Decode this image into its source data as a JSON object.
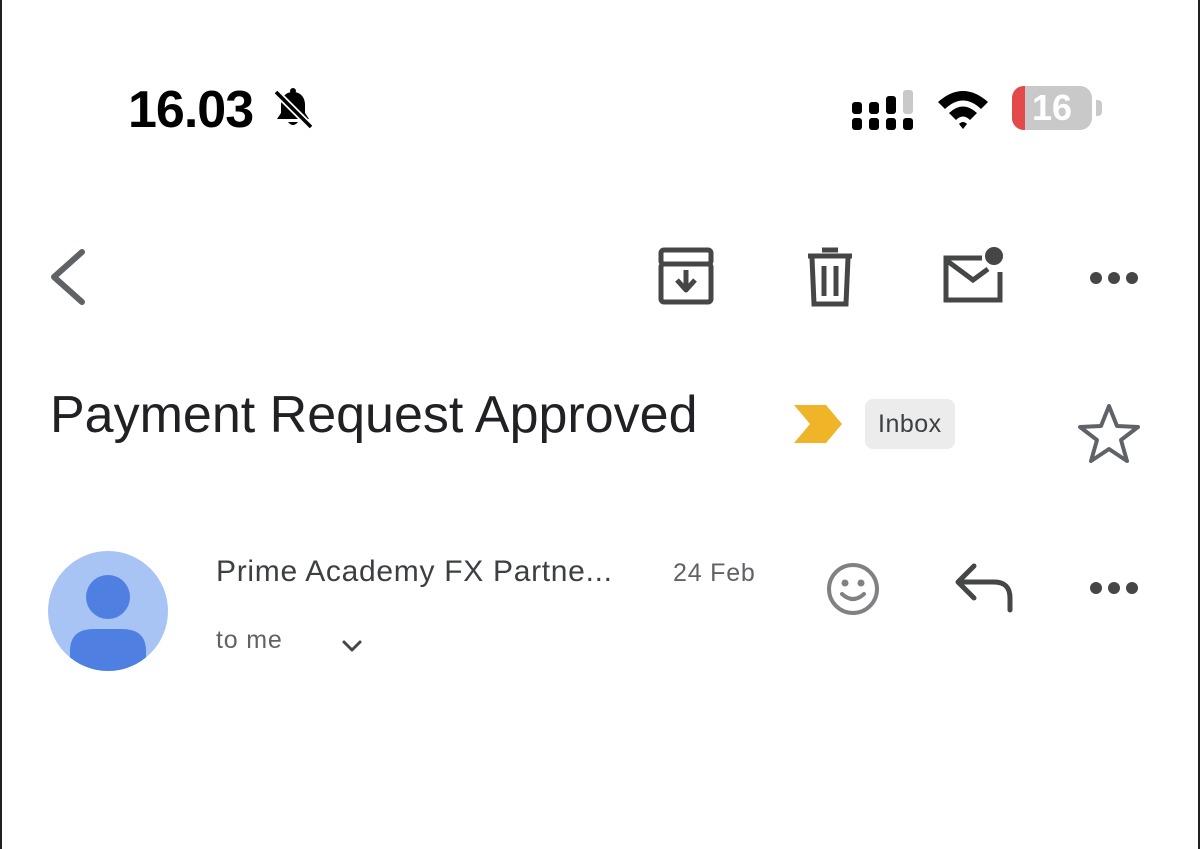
{
  "status_bar": {
    "time": "16.03",
    "battery_level": "16",
    "battery_fraction": 0.16,
    "icons": [
      "bell-slash-icon",
      "signal-icon",
      "wifi-icon",
      "battery-icon"
    ]
  },
  "toolbar": {
    "icons": [
      "back-icon",
      "archive-icon",
      "delete-icon",
      "mark-unread-icon",
      "more-icon"
    ]
  },
  "email": {
    "subject": "Payment Request Approved",
    "label": "Inbox",
    "sender": "Prime Academy FX Partne...",
    "date": "24 Feb",
    "recipient": "to me"
  },
  "colors": {
    "importance_marker": "#f0b429",
    "avatar_bg": "#a8c4f5",
    "avatar_fg": "#4f7fe0",
    "battery_low": "#e34a4a",
    "label_chip_bg": "#ececec"
  }
}
